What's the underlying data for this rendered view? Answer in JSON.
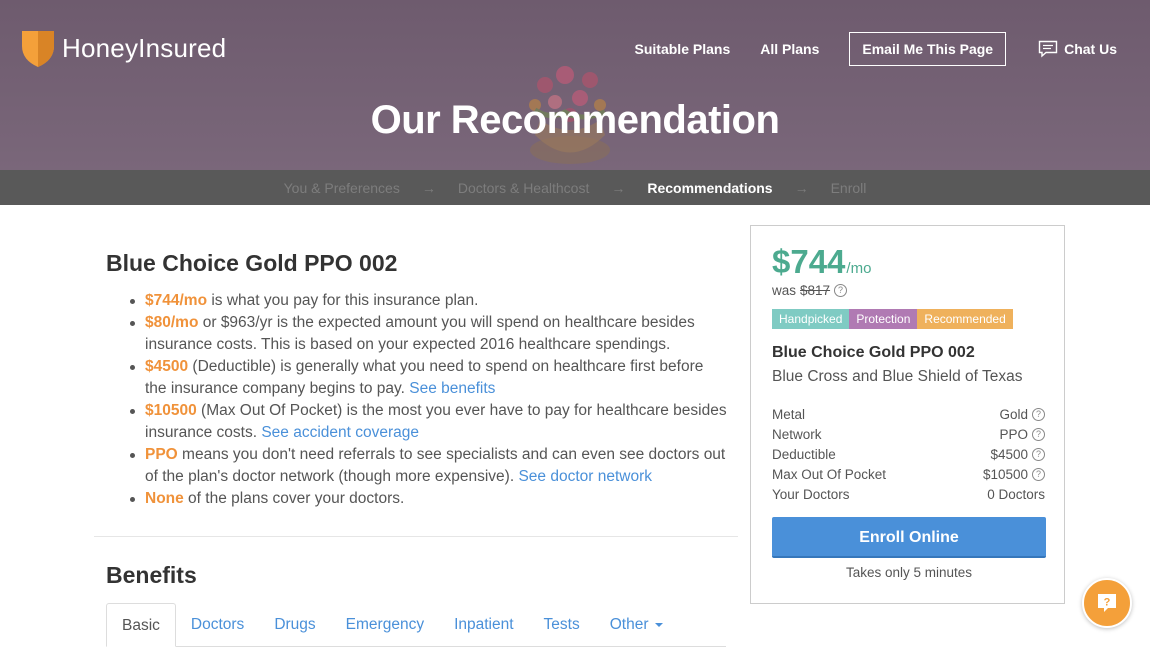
{
  "header": {
    "logo_text": "HoneyInsured",
    "nav": {
      "suitable_plans": "Suitable Plans",
      "all_plans": "All Plans",
      "email_page": "Email Me This Page",
      "chat": "Chat Us"
    },
    "title": "Our Recommendation"
  },
  "steps": [
    {
      "label": "You & Preferences",
      "state": "done"
    },
    {
      "label": "Doctors & Healthcost",
      "state": "done"
    },
    {
      "label": "Recommendations",
      "state": "active"
    },
    {
      "label": "Enroll",
      "state": "upcoming"
    }
  ],
  "step_arrow": "→",
  "main": {
    "plan_title": "Blue Choice Gold PPO 002",
    "bullets": [
      {
        "highlight": "$744/mo",
        "text": " is what you pay for this insurance plan.",
        "link": ""
      },
      {
        "highlight": "$80/mo",
        "text": " or $963/yr is the expected amount you will spend on healthcare besides insurance costs. This is based on your expected 2016 healthcare spendings.",
        "link": ""
      },
      {
        "highlight": "$4500",
        "text": " (Deductible) is generally what you need to spend on healthcare first before the insurance company begins to pay. ",
        "link": "See benefits"
      },
      {
        "highlight": "$10500",
        "text": " (Max Out Of Pocket) is the most you ever have to pay for healthcare besides insurance costs. ",
        "link": "See accident coverage"
      },
      {
        "highlight": "PPO",
        "text": " means you don't need referrals to see specialists and can even see doctors out of the plan's doctor network (though more expensive). ",
        "link": "See doctor network"
      },
      {
        "highlight": "None",
        "text": " of the plans cover your doctors.",
        "link": ""
      }
    ],
    "benefits_title": "Benefits",
    "tabs": [
      "Basic",
      "Doctors",
      "Drugs",
      "Emergency",
      "Inpatient",
      "Tests",
      "Other"
    ],
    "active_tab": "Basic"
  },
  "card": {
    "price": "$744",
    "price_unit": "/mo",
    "was_label": "was",
    "was_price": "$817",
    "badges": [
      "Handpicked",
      "Protection",
      "Recommended"
    ],
    "plan_name": "Blue Choice Gold PPO 002",
    "carrier": "Blue Cross and Blue Shield of Texas",
    "attributes": [
      {
        "label": "Metal",
        "value": "Gold",
        "help": true
      },
      {
        "label": "Network",
        "value": "PPO",
        "help": true
      },
      {
        "label": "Deductible",
        "value": "$4500",
        "help": true
      },
      {
        "label": "Max Out Of Pocket",
        "value": "$10500",
        "help": true
      },
      {
        "label": "Your Doctors",
        "value": "0 Doctors",
        "help": false
      }
    ],
    "enroll_label": "Enroll Online",
    "takes_text": "Takes only 5 minutes"
  },
  "help_glyph": "?",
  "colors": {
    "accent_orange": "#f0923a",
    "link_blue": "#4a90d9",
    "price_green": "#4caa8f",
    "hero_bg": "#735f73",
    "steps_bg": "#595959"
  }
}
